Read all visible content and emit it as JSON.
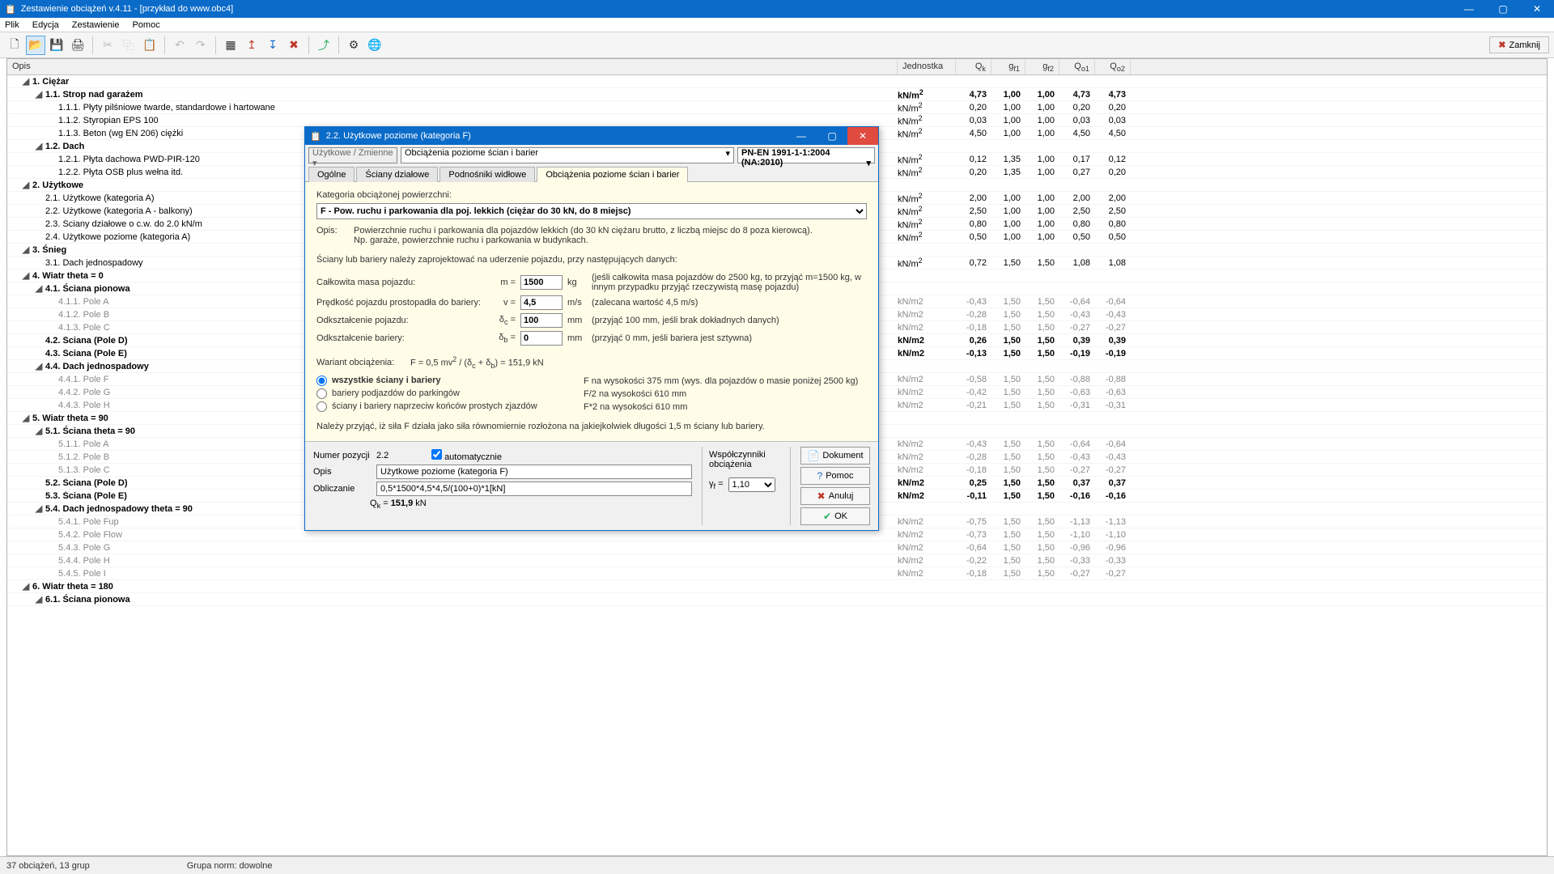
{
  "title": "Zestawienie obciążeń v.4.11 - [przykład do www.obc4]",
  "menu": [
    "Plik",
    "Edycja",
    "Zestawienie",
    "Pomoc"
  ],
  "close_label": "Zamknij",
  "grid_headers": {
    "desc": "Opis",
    "unit": "Jednostka",
    "qk": "Qk",
    "gf1": "gf1",
    "gf2": "gf2",
    "qo1": "Qo1",
    "qo2": "Qo2"
  },
  "rows": [
    {
      "indent": 0,
      "toggle": true,
      "bold": true,
      "label": "1.  Ciężar"
    },
    {
      "indent": 1,
      "toggle": true,
      "bold": true,
      "label": "1.1.  Strop nad garażem",
      "unit": "kN/m²",
      "qk": "4,73",
      "gf1": "1,00",
      "gf2": "1,00",
      "qo1": "4,73",
      "qo2": "4,73"
    },
    {
      "indent": 2,
      "label": "1.1.1.  Płyty pilśniowe twarde, standardowe i hartowane",
      "unit": "kN/m²",
      "qk": "0,20",
      "gf1": "1,00",
      "gf2": "1,00",
      "qo1": "0,20",
      "qo2": "0,20"
    },
    {
      "indent": 2,
      "label": "1.1.2.  Styropian EPS 100",
      "unit": "kN/m²",
      "qk": "0,03",
      "gf1": "1,00",
      "gf2": "1,00",
      "qo1": "0,03",
      "qo2": "0,03"
    },
    {
      "indent": 2,
      "label": "1.1.3.  Beton (wg EN 206) ciężki",
      "unit": "kN/m²",
      "qk": "4,50",
      "gf1": "1,00",
      "gf2": "1,00",
      "qo1": "4,50",
      "qo2": "4,50"
    },
    {
      "indent": 1,
      "toggle": true,
      "bold": true,
      "label": "1.2.  Dach"
    },
    {
      "indent": 2,
      "label": "1.2.1.  Płyta dachowa PWD-PIR-120",
      "unit": "kN/m²",
      "qk": "0,12",
      "gf1": "1,35",
      "gf2": "1,00",
      "qo1": "0,17",
      "qo2": "0,12"
    },
    {
      "indent": 2,
      "label": "1.2.2.  Płyta OSB plus wełna itd.",
      "unit": "kN/m²",
      "qk": "0,20",
      "gf1": "1,35",
      "gf2": "1,00",
      "qo1": "0,27",
      "qo2": "0,20"
    },
    {
      "indent": 0,
      "toggle": true,
      "bold": true,
      "label": "2.  Użytkowe"
    },
    {
      "indent": 1,
      "label": "2.1.  Użytkowe (kategoria A)",
      "unit": "kN/m²",
      "qk": "2,00",
      "gf1": "1,00",
      "gf2": "1,00",
      "qo1": "2,00",
      "qo2": "2,00"
    },
    {
      "indent": 1,
      "label": "2.2.  Użytkowe (kategoria A - balkony)",
      "unit": "kN/m²",
      "qk": "2,50",
      "gf1": "1,00",
      "gf2": "1,00",
      "qo1": "2,50",
      "qo2": "2,50"
    },
    {
      "indent": 1,
      "label": "2.3.  Ściany działowe o c.w. do 2.0 kN/m",
      "unit": "kN/m²",
      "qk": "0,80",
      "gf1": "1,00",
      "gf2": "1,00",
      "qo1": "0,80",
      "qo2": "0,80"
    },
    {
      "indent": 1,
      "label": "2.4.  Użytkowe poziome (kategoria A)",
      "unit": "kN/m²",
      "qk": "0,50",
      "gf1": "1,00",
      "gf2": "1,00",
      "qo1": "0,50",
      "qo2": "0,50"
    },
    {
      "indent": 0,
      "toggle": true,
      "bold": true,
      "label": "3.  Śnieg"
    },
    {
      "indent": 1,
      "label": "3.1.  Dach jednospadowy",
      "unit": "kN/m²",
      "qk": "0,72",
      "gf1": "1,50",
      "gf2": "1,50",
      "qo1": "1,08",
      "qo2": "1,08"
    },
    {
      "indent": 0,
      "toggle": true,
      "bold": true,
      "label": "4.  Wiatr theta = 0"
    },
    {
      "indent": 1,
      "toggle": true,
      "bold": true,
      "label": "4.1.  Ściana pionowa"
    },
    {
      "indent": 2,
      "dim": true,
      "label": "4.1.1.  Pole A",
      "unit": "kN/m2",
      "qk": "-0,43",
      "gf1": "1,50",
      "gf2": "1,50",
      "qo1": "-0,64",
      "qo2": "-0,64"
    },
    {
      "indent": 2,
      "dim": true,
      "label": "4.1.2.  Pole B",
      "unit": "kN/m2",
      "qk": "-0,28",
      "gf1": "1,50",
      "gf2": "1,50",
      "qo1": "-0,43",
      "qo2": "-0,43"
    },
    {
      "indent": 2,
      "dim": true,
      "label": "4.1.3.  Pole C",
      "unit": "kN/m2",
      "qk": "-0,18",
      "gf1": "1,50",
      "gf2": "1,50",
      "qo1": "-0,27",
      "qo2": "-0,27"
    },
    {
      "indent": 1,
      "bold": true,
      "label": "4.2.  Ściana (Pole D)",
      "unit": "kN/m2",
      "qk": "0,26",
      "gf1": "1,50",
      "gf2": "1,50",
      "qo1": "0,39",
      "qo2": "0,39"
    },
    {
      "indent": 1,
      "bold": true,
      "label": "4.3.  Ściana (Pole E)",
      "unit": "kN/m2",
      "qk": "-0,13",
      "gf1": "1,50",
      "gf2": "1,50",
      "qo1": "-0,19",
      "qo2": "-0,19"
    },
    {
      "indent": 1,
      "toggle": true,
      "bold": true,
      "label": "4.4.  Dach jednospadowy"
    },
    {
      "indent": 2,
      "dim": true,
      "label": "4.4.1.  Pole F",
      "unit": "kN/m2",
      "qk": "-0,58",
      "gf1": "1,50",
      "gf2": "1,50",
      "qo1": "-0,88",
      "qo2": "-0,88"
    },
    {
      "indent": 2,
      "dim": true,
      "label": "4.4.2.  Pole G",
      "unit": "kN/m2",
      "qk": "-0,42",
      "gf1": "1,50",
      "gf2": "1,50",
      "qo1": "-0,63",
      "qo2": "-0,63"
    },
    {
      "indent": 2,
      "dim": true,
      "label": "4.4.3.  Pole H",
      "unit": "kN/m2",
      "qk": "-0,21",
      "gf1": "1,50",
      "gf2": "1,50",
      "qo1": "-0,31",
      "qo2": "-0,31"
    },
    {
      "indent": 0,
      "toggle": true,
      "bold": true,
      "label": "5.  Wiatr theta = 90"
    },
    {
      "indent": 1,
      "toggle": true,
      "bold": true,
      "label": "5.1.  Ściana theta = 90"
    },
    {
      "indent": 2,
      "dim": true,
      "label": "5.1.1.  Pole A",
      "unit": "kN/m2",
      "qk": "-0,43",
      "gf1": "1,50",
      "gf2": "1,50",
      "qo1": "-0,64",
      "qo2": "-0,64"
    },
    {
      "indent": 2,
      "dim": true,
      "label": "5.1.2.  Pole B",
      "unit": "kN/m2",
      "qk": "-0,28",
      "gf1": "1,50",
      "gf2": "1,50",
      "qo1": "-0,43",
      "qo2": "-0,43"
    },
    {
      "indent": 2,
      "dim": true,
      "label": "5.1.3.  Pole C",
      "unit": "kN/m2",
      "qk": "-0,18",
      "gf1": "1,50",
      "gf2": "1,50",
      "qo1": "-0,27",
      "qo2": "-0,27"
    },
    {
      "indent": 1,
      "bold": true,
      "label": "5.2.  Ściana (Pole D)",
      "unit": "kN/m2",
      "qk": "0,25",
      "gf1": "1,50",
      "gf2": "1,50",
      "qo1": "0,37",
      "qo2": "0,37"
    },
    {
      "indent": 1,
      "bold": true,
      "label": "5.3.  Ściana (Pole E)",
      "unit": "kN/m2",
      "qk": "-0,11",
      "gf1": "1,50",
      "gf2": "1,50",
      "qo1": "-0,16",
      "qo2": "-0,16"
    },
    {
      "indent": 1,
      "toggle": true,
      "bold": true,
      "label": "5.4.  Dach jednospadowy theta = 90"
    },
    {
      "indent": 2,
      "dim": true,
      "label": "5.4.1.  Pole Fup",
      "unit": "kN/m2",
      "qk": "-0,75",
      "gf1": "1,50",
      "gf2": "1,50",
      "qo1": "-1,13",
      "qo2": "-1,13"
    },
    {
      "indent": 2,
      "dim": true,
      "label": "5.4.2.  Pole Flow",
      "unit": "kN/m2",
      "qk": "-0,73",
      "gf1": "1,50",
      "gf2": "1,50",
      "qo1": "-1,10",
      "qo2": "-1,10"
    },
    {
      "indent": 2,
      "dim": true,
      "label": "5.4.3.  Pole G",
      "unit": "kN/m2",
      "qk": "-0,64",
      "gf1": "1,50",
      "gf2": "1,50",
      "qo1": "-0,96",
      "qo2": "-0,96"
    },
    {
      "indent": 2,
      "dim": true,
      "label": "5.4.4.  Pole H",
      "unit": "kN/m2",
      "qk": "-0,22",
      "gf1": "1,50",
      "gf2": "1,50",
      "qo1": "-0,33",
      "qo2": "-0,33"
    },
    {
      "indent": 2,
      "dim": true,
      "label": "5.4.5.  Pole I",
      "unit": "kN/m2",
      "qk": "-0,18",
      "gf1": "1,50",
      "gf2": "1,50",
      "qo1": "-0,27",
      "qo2": "-0,27"
    },
    {
      "indent": 0,
      "toggle": true,
      "bold": true,
      "label": "6.  Wiatr theta = 180"
    },
    {
      "indent": 1,
      "toggle": true,
      "bold": true,
      "label": "6.1.  Ściana pionowa"
    }
  ],
  "status": {
    "left": "37 obciążeń, 13 grup",
    "right": "Grupa norm: dowolne"
  },
  "dialog": {
    "title": "2.2.  Użytkowe poziome (kategoria F)",
    "top_combo1": "Użytkowe / Zmienne",
    "top_combo2": "Obciążenia poziome ścian i barier",
    "top_combo3": "PN-EN 1991-1-1:2004 (NA:2010)",
    "tabs": [
      "Ogólne",
      "Ściany działowe",
      "Podnośniki widłowe",
      "Obciążenia poziome ścian i barier"
    ],
    "kat_label": "Kategoria obciążonej powierzchni:",
    "kat_value": "F - Pow. ruchu i parkowania dla poj. lekkich (ciężar do 30 kN, do 8 miejsc)",
    "opis_label": "Opis:",
    "opis_text1": "Powierzchnie ruchu i parkowania dla pojazdów lekkich (do 30 kN ciężaru brutto, z liczbą miejsc do 8 poza kierowcą).",
    "opis_text2": "Np. garaże, powierzchnie ruchu i parkowania w budynkach.",
    "info1": "Ściany lub bariery należy zaprojektować na uderzenie pojazdu, przy następujących danych:",
    "m_label": "Całkowita masa pojazdu:",
    "m_sym": "m =",
    "m_val": "1500",
    "m_unit": "kg",
    "m_hint": "(jeśli całkowita masa pojazdów do 2500 kg, to przyjąć m=1500 kg, w innym przypadku przyjąć rzeczywistą masę pojazdu)",
    "v_label": "Prędkość pojazdu prostopadła do bariery:",
    "v_sym": "v =",
    "v_val": "4,5",
    "v_unit": "m/s",
    "v_hint": "(zalecana wartość 4,5 m/s)",
    "dc_label": "Odkształcenie pojazdu:",
    "dc_sym": "δc =",
    "dc_val": "100",
    "dc_unit": "mm",
    "dc_hint": "(przyjąć 100 mm, jeśli brak dokładnych danych)",
    "db_label": "Odkształcenie bariery:",
    "db_sym": "δb =",
    "db_val": "0",
    "db_unit": "mm",
    "db_hint": "(przyjąć 0 mm, jeśli bariera jest sztywna)",
    "wariant_label": "Wariant obciążenia:",
    "formula": "F = 0,5 mv² / (δc + δb) = 151,9 kN",
    "radio1": "wszystkie ściany i bariery",
    "radio1_note": "F  na wysokości 375 mm  (wys. dla pojazdów o masie poniżej 2500 kg)",
    "radio2": "bariery podjazdów do parkingów",
    "radio2_note": "F/2  na wysokości 610 mm",
    "radio3": "ściany i bariery naprzeciw końców prostych zjazdów",
    "radio3_note": "F*2  na wysokości 610 mm",
    "info2": "Należy przyjąć, iż siła F działa jako siła równomiernie rozłożona na jakiejkolwiek długości 1,5 m ściany lub bariery.",
    "bottom": {
      "pos_label": "Numer pozycji",
      "pos_val": "2.2",
      "auto_label": "automatycznie",
      "opis_label": "Opis",
      "opis_val": "Użytkowe poziome (kategoria F)",
      "obl_label": "Obliczanie",
      "obl_val": "0,5*1500*4,5*4,5/(100+0)*1[kN]",
      "qk_label": "Qk = ",
      "qk_val": "151,9",
      "qk_unit": "kN",
      "coef_title": "Współczynniki obciążenia",
      "gf_label": "γf =",
      "gf_val": "1,10",
      "btn_doc": "Dokument",
      "btn_help": "Pomoc",
      "btn_cancel": "Anuluj",
      "btn_ok": "OK"
    }
  }
}
